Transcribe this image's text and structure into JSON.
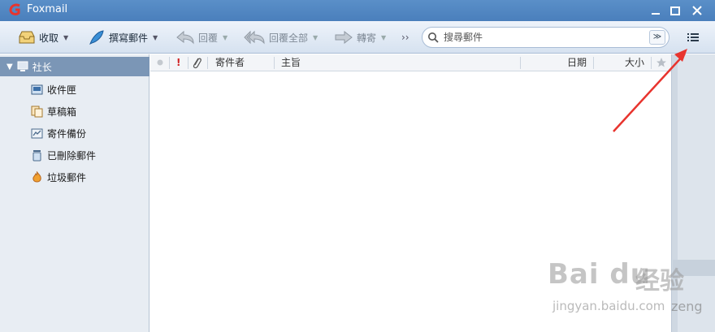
{
  "window": {
    "title": "Foxmail"
  },
  "toolbar": {
    "receive": "收取",
    "compose": "撰寫郵件",
    "reply": "回覆",
    "reply_all": "回覆全部",
    "forward": "轉寄",
    "more": "››",
    "search_placeholder": "搜尋郵件",
    "search_dropdown": "≫"
  },
  "sidebar": {
    "account": "社长",
    "folders": [
      {
        "label": "收件匣",
        "icon": "inbox-icon"
      },
      {
        "label": "草稿箱",
        "icon": "drafts-icon"
      },
      {
        "label": "寄件備份",
        "icon": "sent-icon"
      },
      {
        "label": "已刪除郵件",
        "icon": "trash-icon"
      },
      {
        "label": "垃圾郵件",
        "icon": "junk-icon"
      }
    ]
  },
  "columns": {
    "priority": "!",
    "sender": "寄件者",
    "subject": "主旨",
    "date": "日期",
    "size": "大小"
  },
  "watermark": {
    "logo": "Bai du",
    "cn": "经验",
    "url": "jingyan.baidu.com",
    "extra": "zeng"
  },
  "colors": {
    "titlebar": "#4a7fbc",
    "account_row": "#7b96b6",
    "annotation_arrow": "#e8342e"
  }
}
